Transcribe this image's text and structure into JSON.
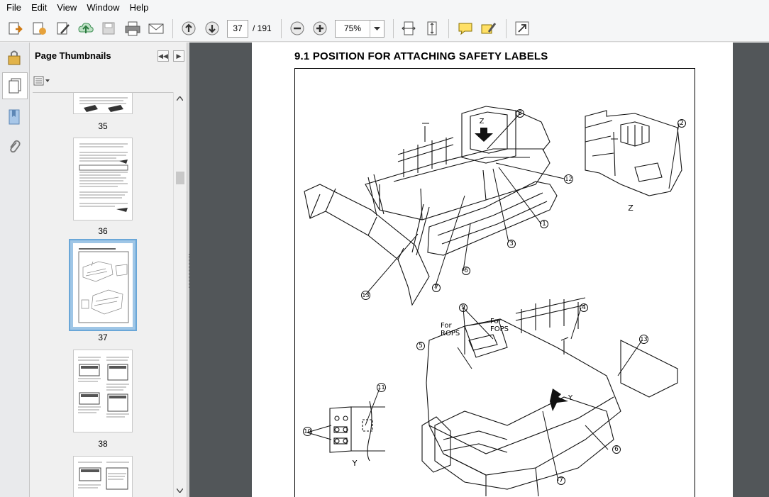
{
  "menu": {
    "items": [
      "File",
      "Edit",
      "View",
      "Window",
      "Help"
    ]
  },
  "toolbar": {
    "current_page": "37",
    "total_pages": "/ 191",
    "zoom": "75%",
    "icons": [
      "create-icon",
      "export-icon",
      "edit-icon",
      "upload-icon",
      "save-icon",
      "print-icon",
      "email-icon",
      "page-up-icon",
      "page-down-icon",
      "zoom-out-icon",
      "zoom-in-icon",
      "fit-width-icon",
      "fit-page-icon",
      "comment-icon",
      "highlight-icon",
      "expand-icon"
    ]
  },
  "nav_panel": {
    "title": "Page Thumbnails",
    "rail_icons": [
      "lock-icon",
      "pages-icon",
      "bookmark-icon",
      "attachment-icon"
    ],
    "thumbnails": [
      {
        "num": "35"
      },
      {
        "num": "36"
      },
      {
        "num": "37",
        "selected": true
      },
      {
        "num": "38"
      }
    ]
  },
  "document": {
    "heading": "9.1  POSITION FOR ATTACHING SAFETY LABELS",
    "labels": {
      "view_z": "Z",
      "view_y": "Y",
      "arrow_z": "Z",
      "arrow_y": "Y",
      "for_rops": "For\nROPS",
      "for_fops": "For\nFOPS"
    },
    "callouts": [
      "1",
      "2",
      "3",
      "4",
      "5",
      "6",
      "7",
      "8",
      "9",
      "10",
      "11",
      "12",
      "13"
    ]
  },
  "colors": {
    "doc_bg": "#525659",
    "selection": "#9fc6e6"
  }
}
